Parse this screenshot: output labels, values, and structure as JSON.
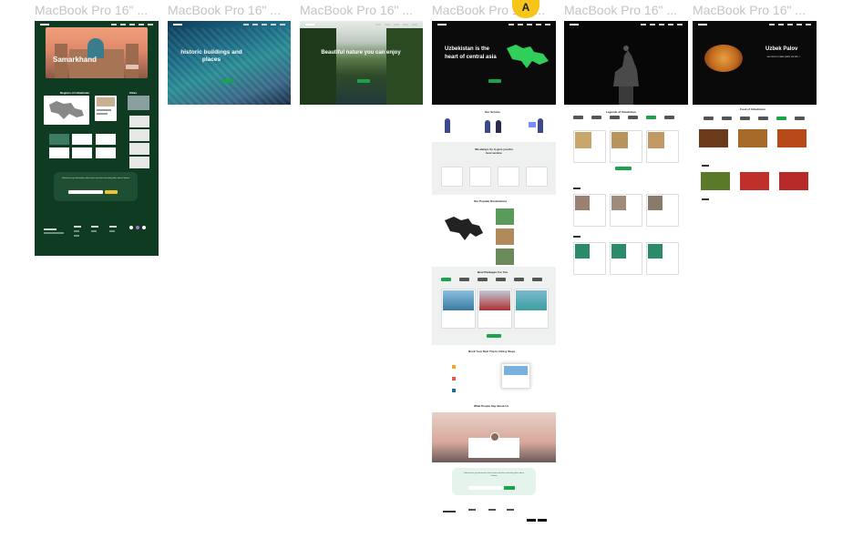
{
  "frames": [
    {
      "label": "MacBook Pro 16\" ..."
    },
    {
      "label": "MacBook Pro 16\" ..."
    },
    {
      "label": "MacBook Pro 16\" ..."
    },
    {
      "label": "MacBook Pro 16\" ..."
    },
    {
      "label": "MacBook Pro 16\" ..."
    },
    {
      "label": "MacBook Pro 16\" ..."
    }
  ],
  "collaborator": {
    "initial": "A",
    "color": "#f5c518"
  },
  "frame1": {
    "hero_title": "Samarkhand",
    "regions_title": "Regions of Uzbekistan",
    "cities_title": "Cities",
    "subscribe_text": "Subscribe to get information, latest news and other interesting offers about Cobham"
  },
  "frame2": {
    "hero_title": "historic buildings and places"
  },
  "frame3": {
    "hero_title": "Beautiful nature you can enjoy"
  },
  "frame4": {
    "hero_title": "Uzbekistan is the heart of central asia",
    "service_title": "Our Service",
    "best_service_title": "We always try to give you the best service",
    "destinations_title": "Our Popular Destinations",
    "packages_title": "Best Packages For You",
    "trip_title": "Book Your Next Trip In 3 Easy Steps",
    "testimonials_title": "What People Say About Us",
    "subscribe_text": "Subscribe to get information, latest news and other interesting offers about Cobham"
  },
  "frame5": {
    "legends_title": "Legends of Uzbekistan"
  },
  "frame6": {
    "hero_title": "Uzbek Palov",
    "hero_subtitle": "see how to make palov via link ->",
    "food_title": "Food of Uzbekistan"
  },
  "colors": {
    "brand_green": "#1aa34a",
    "dark_green": "#0f3b22",
    "dark": "#0d0d0d"
  }
}
